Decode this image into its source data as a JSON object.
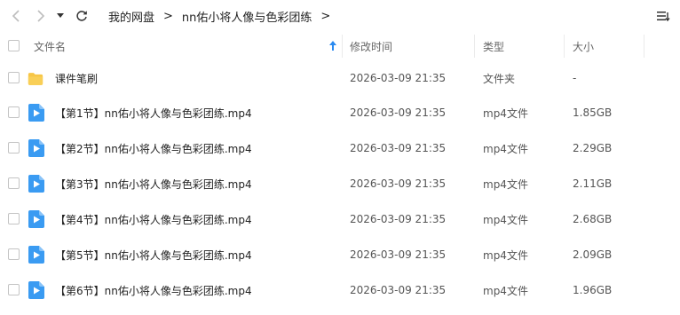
{
  "toolbar": {
    "back_icon": "chevron-left-icon",
    "forward_icon": "chevron-right-icon",
    "history_icon": "caret-down-icon",
    "refresh_icon": "refresh-icon",
    "view_icon": "list-view-icon"
  },
  "breadcrumb": {
    "items": [
      "我的网盘",
      "nn佑小将人像与色彩团练"
    ],
    "separator": ">"
  },
  "table": {
    "columns": {
      "name": "文件名",
      "modified": "修改时间",
      "type": "类型",
      "size": "大小"
    },
    "sort_icon": "sort-ascending-icon",
    "rows": [
      {
        "name": "课件笔刷",
        "modified": "2026-03-09 21:35",
        "type": "文件夹",
        "size": "-",
        "icon": "folder-icon"
      },
      {
        "name": "【第1节】nn佑小将人像与色彩团练.mp4",
        "modified": "2026-03-09 21:35",
        "type": "mp4文件",
        "size": "1.85GB",
        "icon": "video-file-icon"
      },
      {
        "name": "【第2节】nn佑小将人像与色彩团练.mp4",
        "modified": "2026-03-09 21:35",
        "type": "mp4文件",
        "size": "2.29GB",
        "icon": "video-file-icon"
      },
      {
        "name": "【第3节】nn佑小将人像与色彩团练.mp4",
        "modified": "2026-03-09 21:35",
        "type": "mp4文件",
        "size": "2.11GB",
        "icon": "video-file-icon"
      },
      {
        "name": "【第4节】nn佑小将人像与色彩团练.mp4",
        "modified": "2026-03-09 21:35",
        "type": "mp4文件",
        "size": "2.68GB",
        "icon": "video-file-icon"
      },
      {
        "name": "【第5节】nn佑小将人像与色彩团练.mp4",
        "modified": "2026-03-09 21:35",
        "type": "mp4文件",
        "size": "2.09GB",
        "icon": "video-file-icon"
      },
      {
        "name": "【第6节】nn佑小将人像与色彩团练.mp4",
        "modified": "2026-03-09 21:35",
        "type": "mp4文件",
        "size": "1.96GB",
        "icon": "video-file-icon"
      }
    ]
  },
  "colors": {
    "folder": "#f7c646",
    "video": "#3a9bf2",
    "sort_arrow": "#2a8af0"
  }
}
